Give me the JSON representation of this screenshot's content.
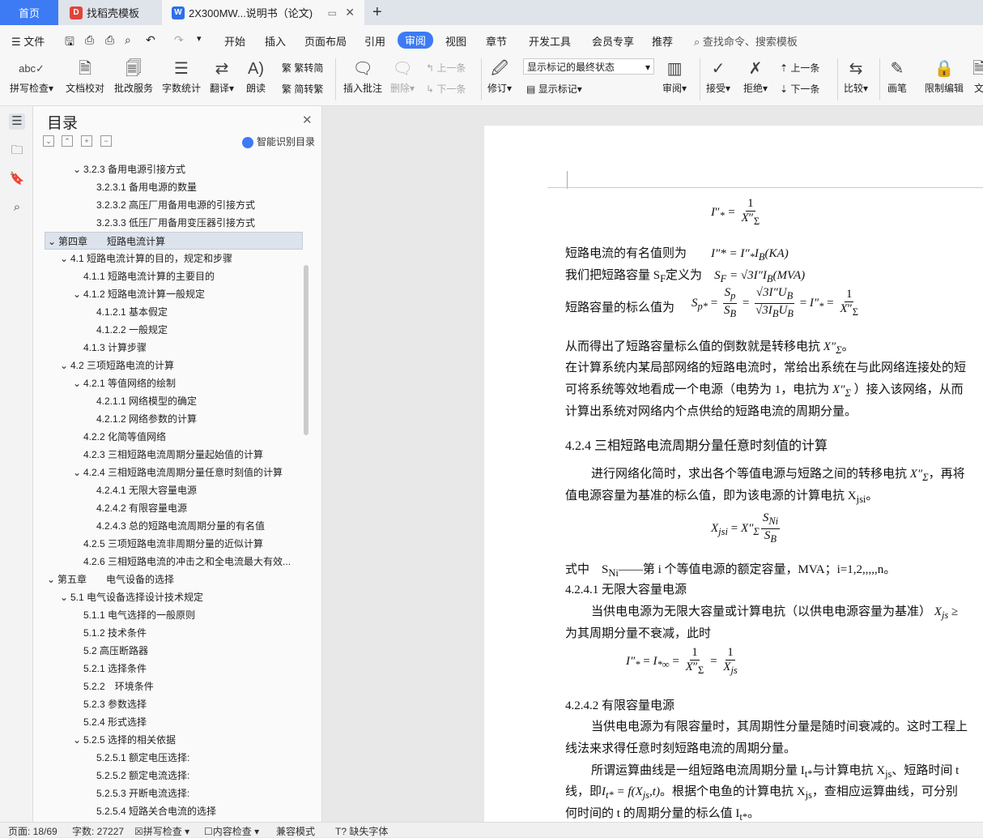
{
  "tabs": {
    "home": "首页",
    "templates": "找稻壳模板",
    "document": "2X300MW...说明书（论文)"
  },
  "menu": {
    "file": "文件",
    "items": [
      "开始",
      "插入",
      "页面布局",
      "引用",
      "审阅",
      "视图",
      "章节",
      "开发工具",
      "会员专享",
      "推荐"
    ],
    "active": "审阅",
    "search": "查找命令、搜索模板"
  },
  "ribbon": {
    "spell_check": "拼写检查",
    "doc_check": "文档校对",
    "annotate_service": "批改服务",
    "word_count": "字数统计",
    "translate": "翻译",
    "read_aloud": "朗读",
    "trad_to_simp": "繁转简",
    "simp_to_trad": "简转繁",
    "insert_comment": "插入批注",
    "delete": "删除",
    "prev_comment": "上一条",
    "next_comment": "下一条",
    "track_changes": "修订",
    "display_state": "显示标记的最终状态",
    "show_markup": "显示标记",
    "review": "审阅",
    "accept": "接受",
    "reject": "拒绝",
    "prev_change": "上一条",
    "next_change": "下一条",
    "compare": "比较",
    "pen": "画笔",
    "restrict_edit": "限制编辑",
    "doc_cut": "文"
  },
  "toc": {
    "title": "目录",
    "smart": "智能识别目录",
    "items": [
      {
        "text": "3.2.3 备用电源引接方式",
        "level": 3,
        "arrow": true
      },
      {
        "text": "3.2.3.1 备用电源的数量",
        "level": 4,
        "arrow": false
      },
      {
        "text": "3.2.3.2 高压厂用备用电源的引接方式",
        "level": 4,
        "arrow": false
      },
      {
        "text": "3.2.3.3 低压厂用备用变压器引接方式",
        "level": 4,
        "arrow": false
      },
      {
        "text": "第四章　　短路电流计算",
        "level": 1,
        "arrow": true,
        "selected": true
      },
      {
        "text": "4.1 短路电流计算的目的，规定和步骤",
        "level": 2,
        "arrow": true
      },
      {
        "text": "4.1.1 短路电流计算的主要目的",
        "level": 3,
        "arrow": false
      },
      {
        "text": "4.1.2 短路电流计算一般规定",
        "level": 3,
        "arrow": true
      },
      {
        "text": "4.1.2.1 基本假定",
        "level": 4,
        "arrow": false
      },
      {
        "text": "4.1.2.2 一般规定",
        "level": 4,
        "arrow": false
      },
      {
        "text": "4.1.3 计算步骤",
        "level": 3,
        "arrow": false
      },
      {
        "text": "4.2 三项短路电流的计算",
        "level": 2,
        "arrow": true
      },
      {
        "text": "4.2.1 等值网络的绘制",
        "level": 3,
        "arrow": true
      },
      {
        "text": "4.2.1.1 网络模型的确定",
        "level": 4,
        "arrow": false
      },
      {
        "text": "4.2.1.2 网络参数的计算",
        "level": 4,
        "arrow": false
      },
      {
        "text": "4.2.2 化简等值网络",
        "level": 3,
        "arrow": false
      },
      {
        "text": "4.2.3 三相短路电流周期分量起始值的计算",
        "level": 3,
        "arrow": false
      },
      {
        "text": "4.2.4 三相短路电流周期分量任意时刻值的计算",
        "level": 3,
        "arrow": true
      },
      {
        "text": "4.2.4.1 无限大容量电源",
        "level": 4,
        "arrow": false
      },
      {
        "text": "4.2.4.2 有限容量电源",
        "level": 4,
        "arrow": false
      },
      {
        "text": "4.2.4.3 总的短路电流周期分量的有名值",
        "level": 4,
        "arrow": false
      },
      {
        "text": "4.2.5 三项短路电流非周期分量的近似计算",
        "level": 3,
        "arrow": false
      },
      {
        "text": "4.2.6 三相短路电流的冲击之和全电流最大有效...",
        "level": 3,
        "arrow": false
      },
      {
        "text": "第五章　　电气设备的选择",
        "level": 1,
        "arrow": true
      },
      {
        "text": "5.1 电气设备选择设计技术规定",
        "level": 2,
        "arrow": true
      },
      {
        "text": "5.1.1 电气选择的一般原则",
        "level": 3,
        "arrow": false
      },
      {
        "text": "5.1.2 技术条件",
        "level": 3,
        "arrow": false
      },
      {
        "text": "5.2 高压断路器",
        "level": 3,
        "arrow": false
      },
      {
        "text": "5.2.1 选择条件",
        "level": 3,
        "arrow": false
      },
      {
        "text": "5.2.2　环境条件",
        "level": 3,
        "arrow": false
      },
      {
        "text": "5.2.3 参数选择",
        "level": 3,
        "arrow": false
      },
      {
        "text": "5.2.4 形式选择",
        "level": 3,
        "arrow": false
      },
      {
        "text": "5.2.5 选择的相关依据",
        "level": 3,
        "arrow": true
      },
      {
        "text": "5.2.5.1 额定电压选择:",
        "level": 4,
        "arrow": false
      },
      {
        "text": "5.2.5.2 额定电流选择:",
        "level": 4,
        "arrow": false
      },
      {
        "text": "5.2.5.3 开断电流选择:",
        "level": 4,
        "arrow": false
      },
      {
        "text": "5.2.5.4 短路关合电流的选择",
        "level": 4,
        "arrow": false
      }
    ]
  },
  "doc": {
    "l1": "短路电流的有名值则为",
    "l2": "我们把短路容量 S",
    "l2b": "定义为",
    "l3": "短路容量的标么值为",
    "l4": "从而得出了短路容量标么值的倒数就是转移电抗",
    "l5": "在计算系统内某局部网络的短路电流时，常给出系统在与此网络连接处的短",
    "l6a": "可将系统等效地看成一个电源（电势为 1，电抗为",
    "l6b": "）接入该网络，从而",
    "l7": "计算出系统对网络内个点供给的短路电流的周期分量。",
    "h1": "4.2.4 三相短路电流周期分量任意时刻值的计算",
    "p1a": "进行网络化简时，求出各个等值电源与短路之间的转移电抗",
    "p1b": "，再将",
    "p2": "值电源容量为基准的标么值，即为该电源的计算电抗 X",
    "p3": "式中　S",
    "p3b": "——第 i 个等值电源的额定容量，MVA；i=1,2,,,,,n。",
    "h2": "4.2.4.1 无限大容量电源",
    "p4": "当供电电源为无限大容量或计算电抗（以供电电源容量为基准）",
    "p5": "为其周期分量不衰减，此时",
    "h3": "4.2.4.2 有限容量电源",
    "p6": "当供电电源为有限容量时，其周期性分量是随时间衰减的。这时工程上",
    "p7": "线法来求得任意时刻短路电流的周期分量。",
    "p8": "所谓运算曲线是一组短路电流周期分量 I",
    "p8b": "与计算电抗 X",
    "p8c": "、短路时间 t",
    "p9a": "线，即",
    "p9b": "。根据个电鱼的计算电抗 X",
    "p9c": "，查相应运算曲线，可分别",
    "p10": "何时间的 t 的周期分量的标么值 I"
  },
  "status": {
    "page": "页面: 18/69",
    "words": "字数: 27227",
    "spell": "拼写检查",
    "content_check": "内容检查",
    "compat": "兼容模式",
    "missing_font": "缺失字体"
  }
}
